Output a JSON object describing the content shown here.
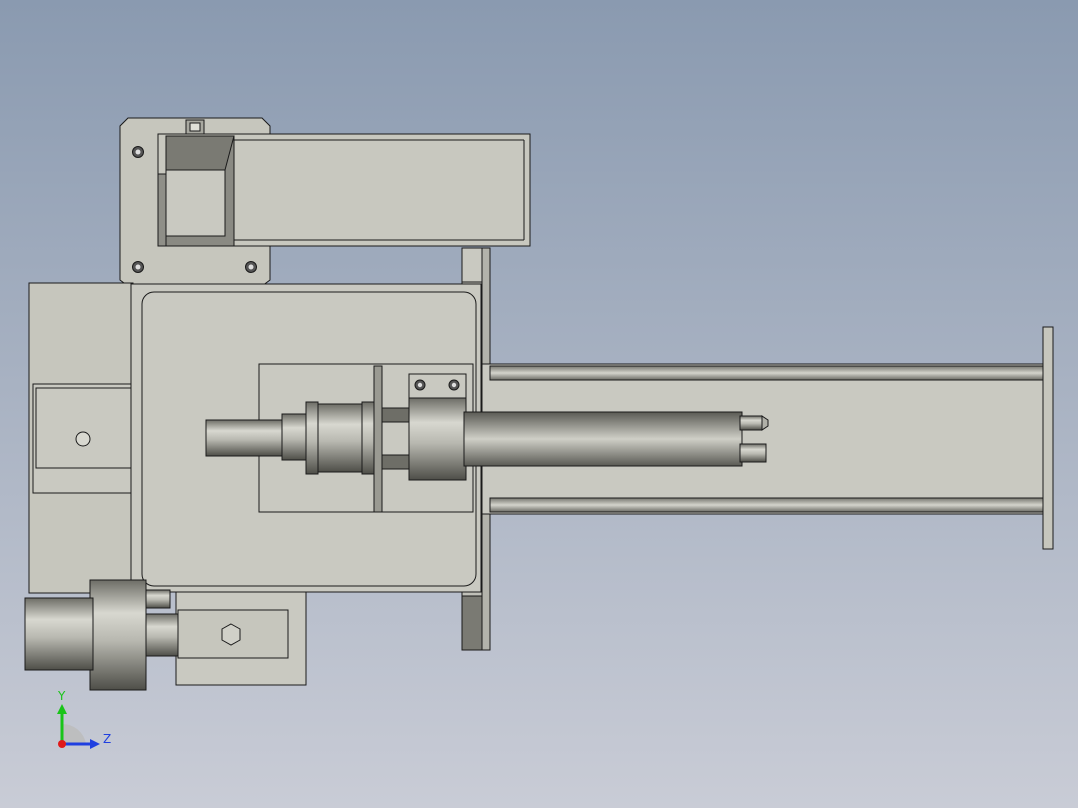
{
  "viewport": {
    "background_top": "#8a9ab0",
    "background_bottom": "#c9ccd6"
  },
  "colors": {
    "part_fill": "#c6c6bd",
    "part_fill_light": "#d0d0c8",
    "part_edge": "#1a1a1a",
    "shade_dark": "#5e5e58",
    "shade_mid": "#9a9a92"
  },
  "triad": {
    "y_label": "Y",
    "z_label": "Z",
    "y_color": "#19c419",
    "z_color": "#1f3fe0",
    "x_color": "#e01a1a"
  }
}
